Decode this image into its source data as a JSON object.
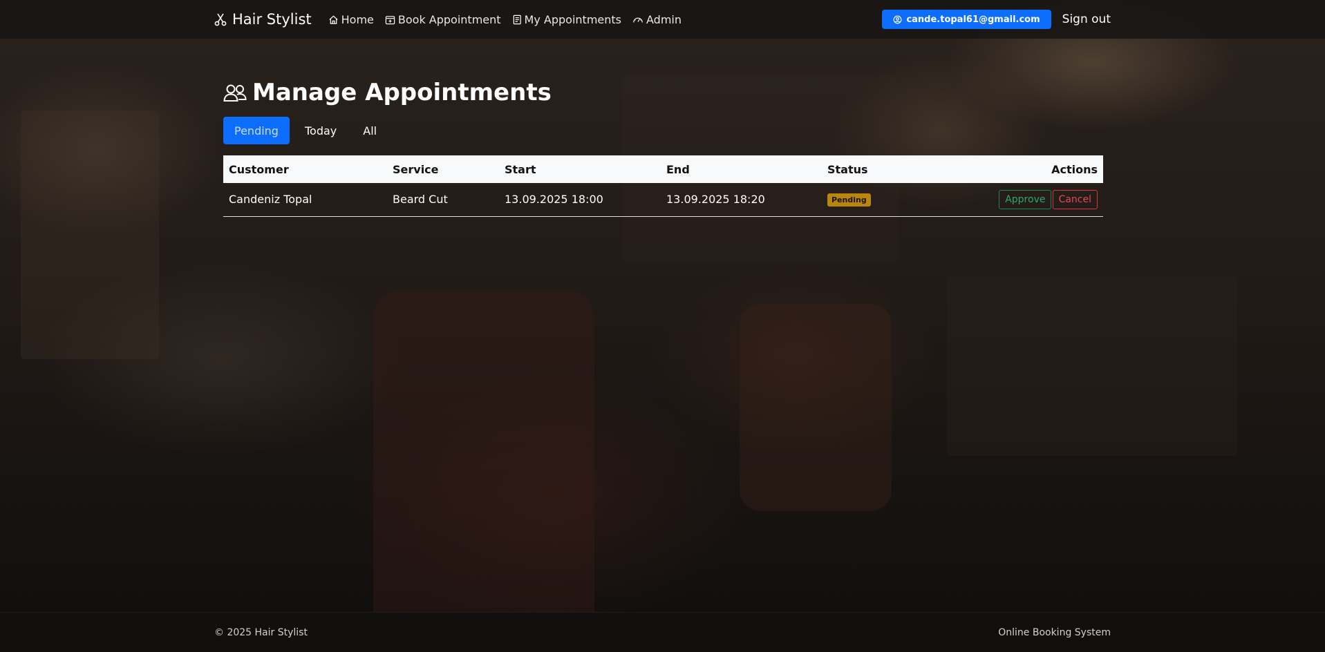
{
  "brand": {
    "name": "Hair Stylist",
    "icon": "scissors-icon"
  },
  "nav": {
    "items": [
      {
        "label": "Home",
        "icon": "home-icon"
      },
      {
        "label": "Book Appointment",
        "icon": "calendar-plus-icon"
      },
      {
        "label": "My Appointments",
        "icon": "journal-icon"
      },
      {
        "label": "Admin",
        "icon": "speedometer-icon"
      }
    ],
    "user_email": "cande.topal61@gmail.com",
    "sign_out": "Sign out"
  },
  "page": {
    "title": "Manage Appointments",
    "title_icon": "people-icon",
    "tabs": [
      {
        "label": "Pending",
        "active": true
      },
      {
        "label": "Today",
        "active": false
      },
      {
        "label": "All",
        "active": false
      }
    ]
  },
  "table": {
    "headers": [
      "Customer",
      "Service",
      "Start",
      "End",
      "Status",
      "Actions"
    ],
    "rows": [
      {
        "customer": "Candeniz Topal",
        "service": "Beard Cut",
        "start": "13.09.2025 18:00",
        "end": "13.09.2025 18:20",
        "status": "Pending",
        "approve": "Approve",
        "cancel": "Cancel"
      }
    ]
  },
  "footer": {
    "left": "© 2025 Hair Stylist",
    "right": "Online Booking System"
  },
  "colors": {
    "primary": "#0d6efd",
    "status_pending": "#b8860b",
    "approve": "#198754",
    "cancel": "#dc3545"
  }
}
